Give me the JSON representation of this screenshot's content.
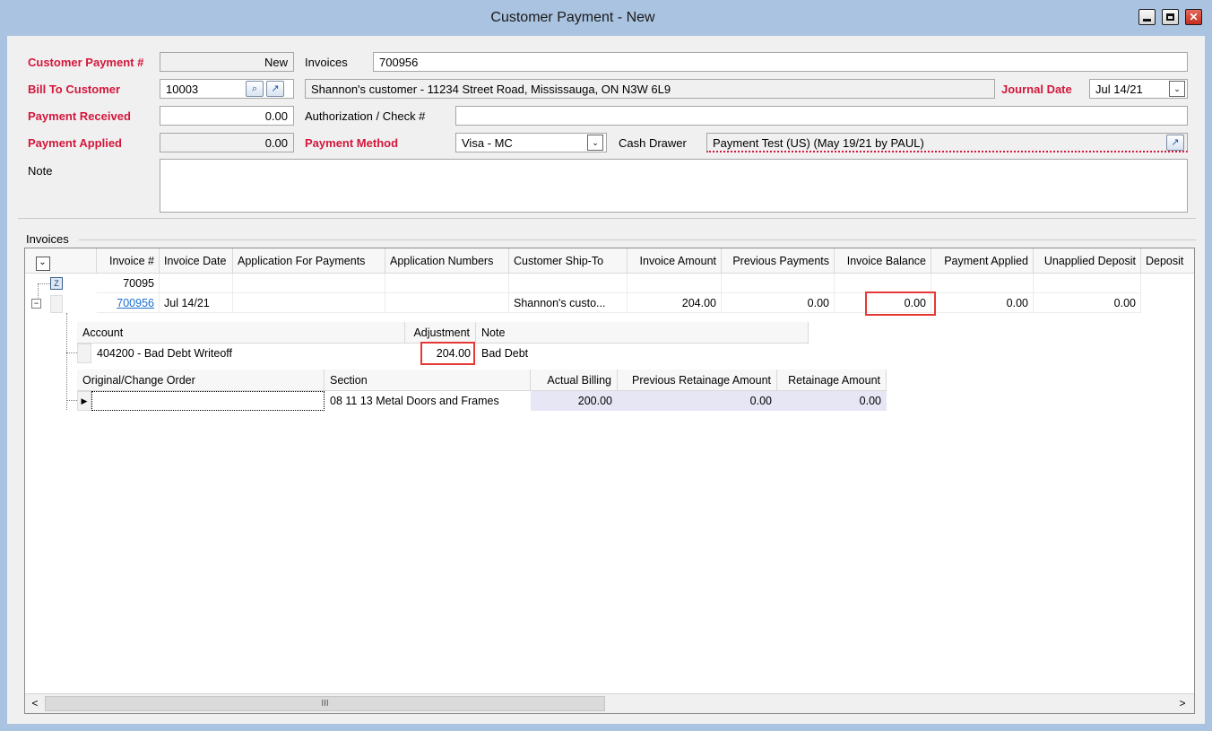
{
  "window": {
    "title": "Customer Payment - New",
    "close_glyph": "✕"
  },
  "header": {
    "customer_payment_label": "Customer Payment #",
    "customer_payment_value": "New",
    "invoices_label": "Invoices",
    "invoices_value": "700956",
    "bill_to_label": "Bill To Customer",
    "bill_to_value": "10003",
    "bill_to_desc": "Shannon's customer - 11234 Street Road, Mississauga, ON  N3W 6L9",
    "journal_date_label": "Journal Date",
    "journal_date_value": "Jul 14/21",
    "payment_received_label": "Payment Received",
    "payment_received_value": "0.00",
    "auth_label": "Authorization / Check #",
    "auth_value": "",
    "payment_applied_label": "Payment Applied",
    "payment_applied_value": "0.00",
    "payment_method_label": "Payment Method",
    "payment_method_value": "Visa - MC",
    "cash_drawer_label": "Cash Drawer",
    "cash_drawer_value": "Payment Test (US) (May 19/21 by PAUL)",
    "note_label": "Note",
    "note_value": ""
  },
  "invoices_group": {
    "label": "Invoices",
    "columns": [
      "Invoice #",
      "Invoice Date",
      "Application For Payments",
      "Application Numbers",
      "Customer Ship-To",
      "Invoice Amount",
      "Previous Payments",
      "Invoice Balance",
      "Payment Applied",
      "Unapplied Deposit",
      "Deposit"
    ],
    "filter_row": {
      "invoice": "70095"
    },
    "row": {
      "invoice": "700956",
      "date": "Jul 14/21",
      "ship_to": "Shannon's custo...",
      "amount": "204.00",
      "previous": "0.00",
      "balance": "0.00",
      "applied": "0.00",
      "unapplied": "0.00"
    },
    "adjustments": {
      "columns": [
        "Account",
        "Adjustment",
        "Note"
      ],
      "row": {
        "account": "404200 - Bad Debt Writeoff",
        "adjustment": "204.00",
        "note": "Bad Debt"
      }
    },
    "billing": {
      "columns": [
        "Original/Change Order",
        "Section",
        "Actual Billing",
        "Previous Retainage Amount",
        "Retainage Amount"
      ],
      "row": {
        "order": "",
        "section": "08 11 13 Metal Doors and Frames",
        "actual": "200.00",
        "prev_retainage": "0.00",
        "retainage": "0.00"
      }
    }
  },
  "icons": {
    "expand": "⊟",
    "row_pointer": "▶",
    "dropdown": "⌄",
    "scroll_left": "<",
    "scroll_right": ">",
    "scroll_grip": "III"
  }
}
